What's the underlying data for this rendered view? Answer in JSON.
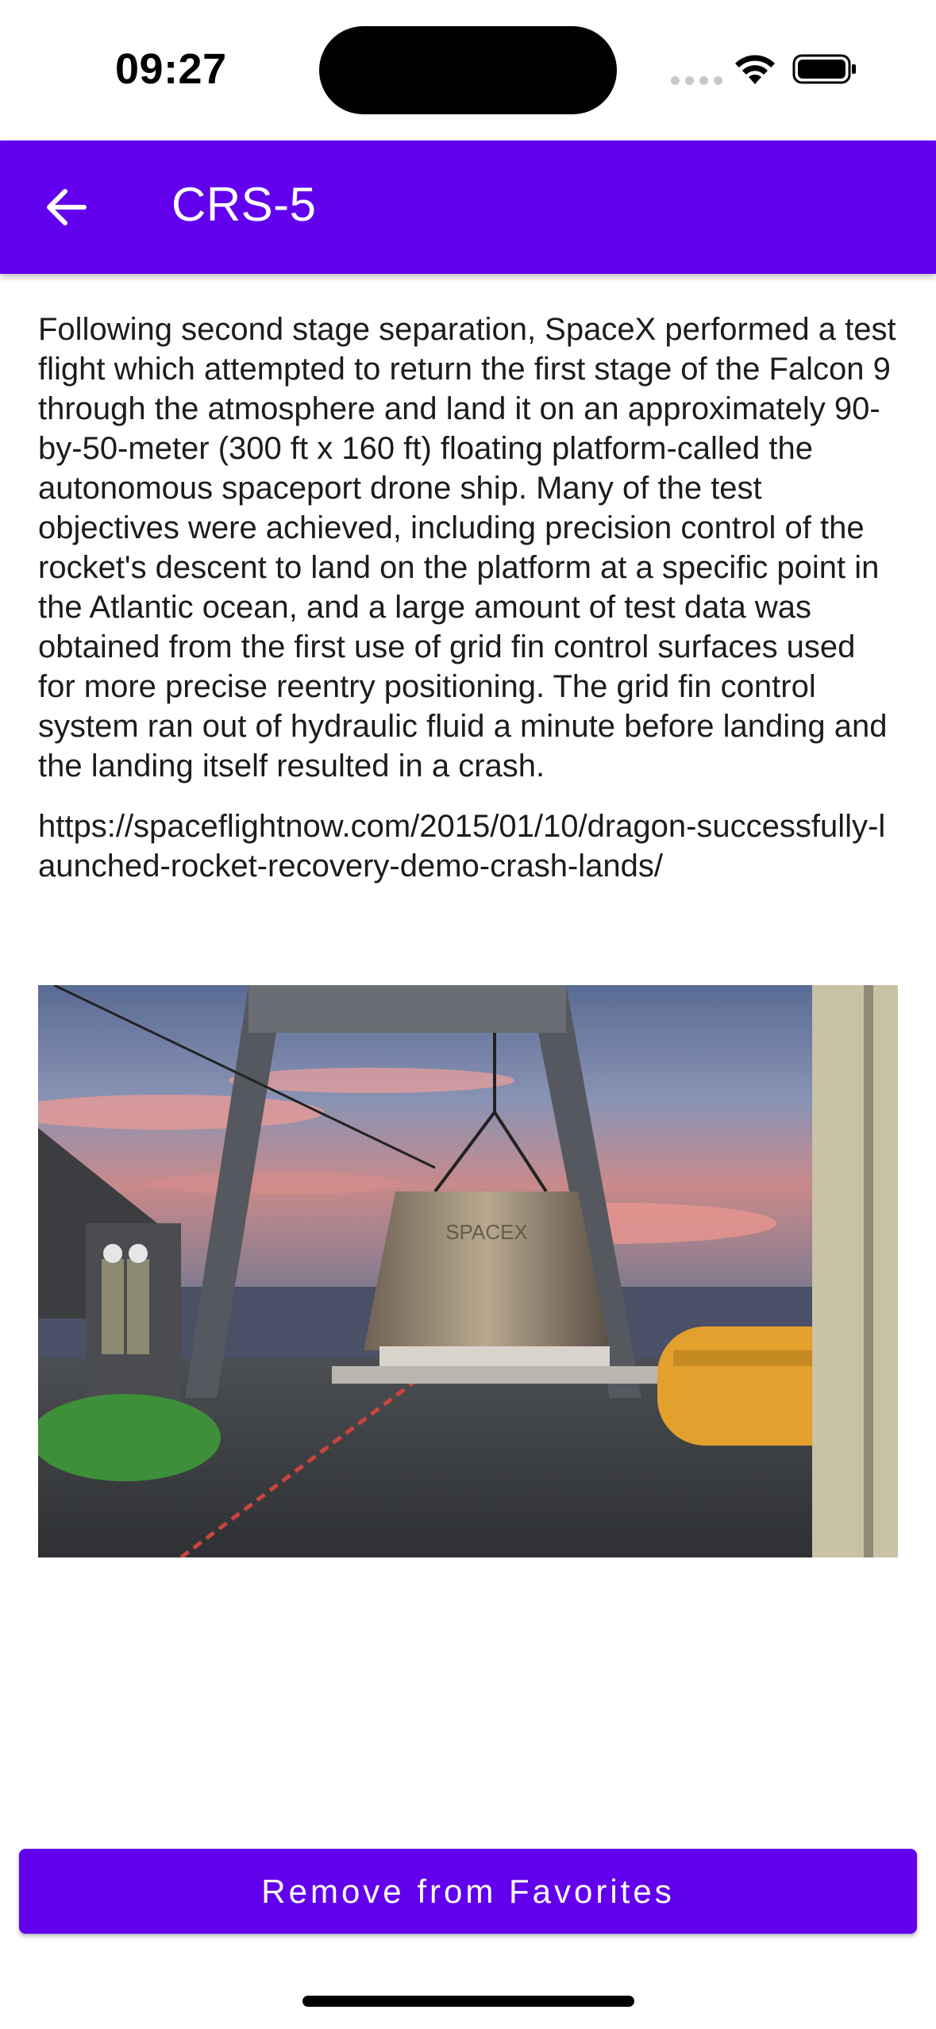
{
  "status_bar": {
    "time": "09:27"
  },
  "app_bar": {
    "title": "CRS-5",
    "back_icon": "arrow-left-icon"
  },
  "mission": {
    "details": "Following second stage separation, SpaceX performed a test flight which attempted to return the first stage of the Falcon 9 through the atmosphere and land it on an approximately 90-by-50-meter (300 ft x 160 ft) floating platform-called the autonomous spaceport drone ship. Many of the test objectives were achieved, including precision control of the rocket's descent to land on the platform at a specific point in the Atlantic ocean, and a large amount of test data was obtained from the first use of grid fin control surfaces used for more precise reentry positioning. The grid fin control system ran out of hydraulic fluid a minute before landing and the landing itself resulted in a crash.",
    "article_link": "https://spaceflightnow.com/2015/01/10/dragon-successfully-launched-rocket-recovery-demo-crash-lands/",
    "image_text": "SPACEX"
  },
  "actions": {
    "remove_label": "Remove from Favorites"
  },
  "colors": {
    "primary": "#6200ee",
    "on_primary": "#ffffff",
    "text": "#1c1b1f"
  }
}
